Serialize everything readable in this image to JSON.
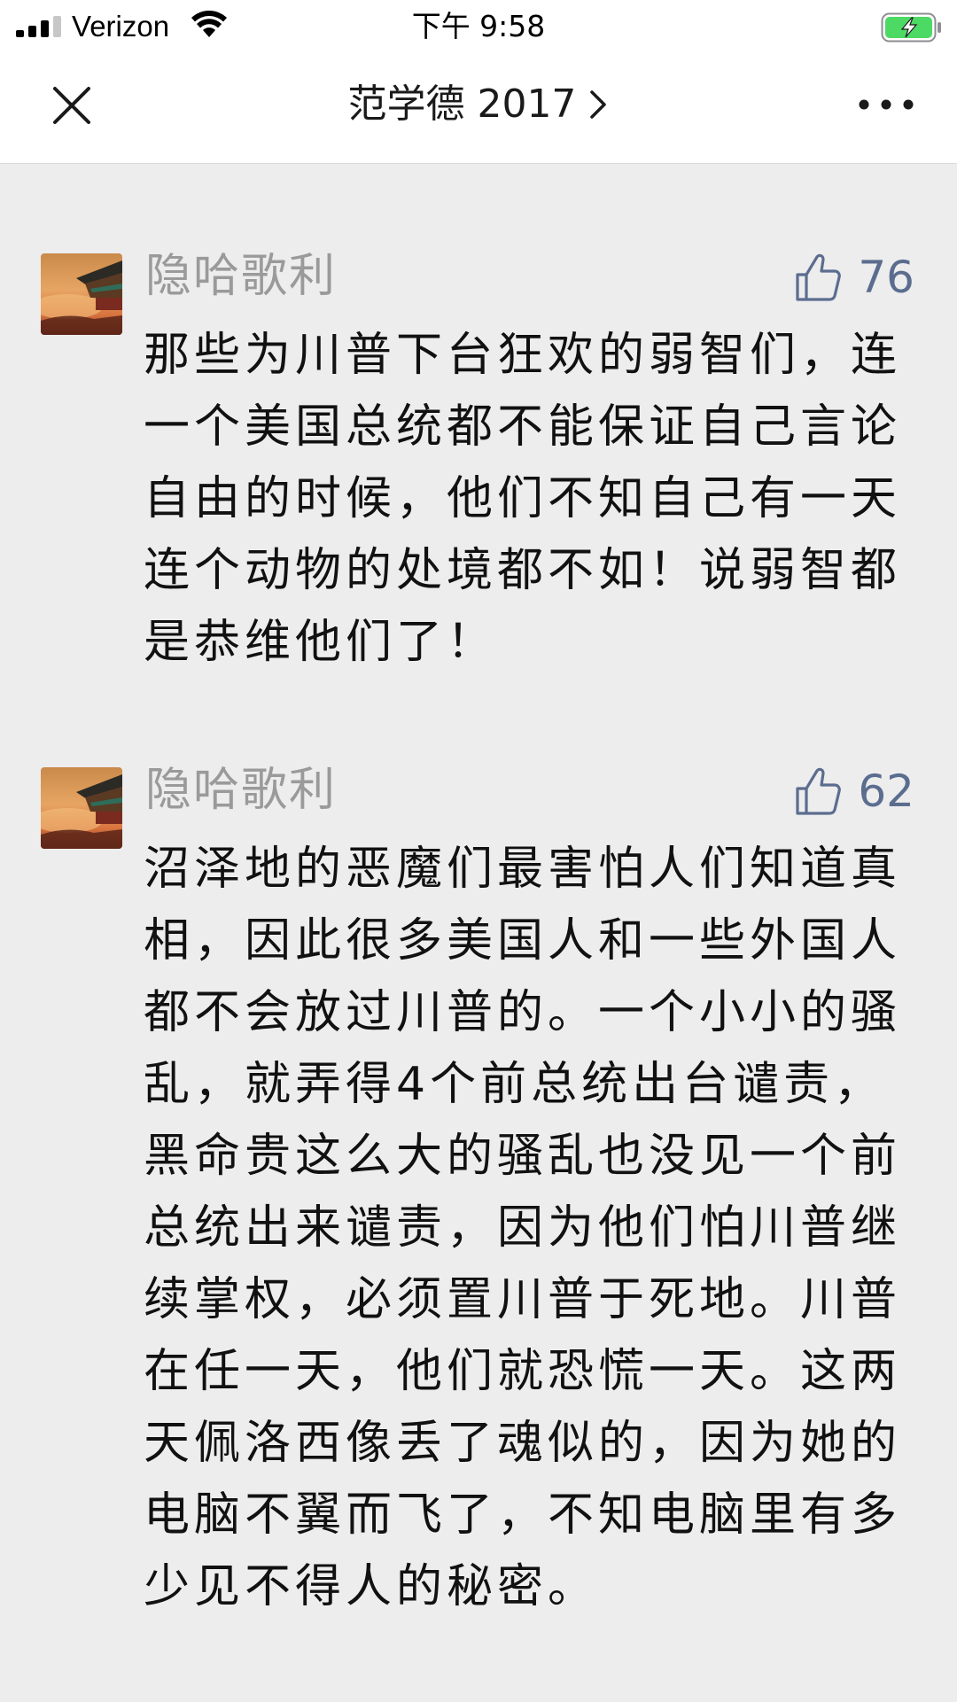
{
  "status_bar": {
    "carrier": "Verizon",
    "time": "下午 9:58",
    "battery_color": "#4cd964"
  },
  "nav": {
    "title": "范学德 2017"
  },
  "comments": [
    {
      "author": "隐哈歌利",
      "likes": "76",
      "text": "那些为川普下台狂欢的弱智们，连一个美国总统都不能保证自己言论自由的时候，他们不知自己有一天连个动物的处境都不如！说弱智都是恭维他们了！"
    },
    {
      "author": "隐哈歌利",
      "likes": "62",
      "text": "沼泽地的恶魔们最害怕人们知道真相，因此很多美国人和一些外国人都不会放过川普的。一个小小的骚乱，就弄得4个前总统出台谴责，黑命贵这么大的骚乱也没见一个前总统出来谴责，因为他们怕川普继续掌权，必须置川普于死地。川普在任一天，他们就恐慌一天。这两天佩洛西像丢了魂似的，因为她的电脑不翼而飞了，不知电脑里有多少见不得人的秘密。"
    }
  ],
  "colors": {
    "background": "#ededed",
    "author": "#9a9a9a",
    "like_accent": "#5b6d8f"
  }
}
